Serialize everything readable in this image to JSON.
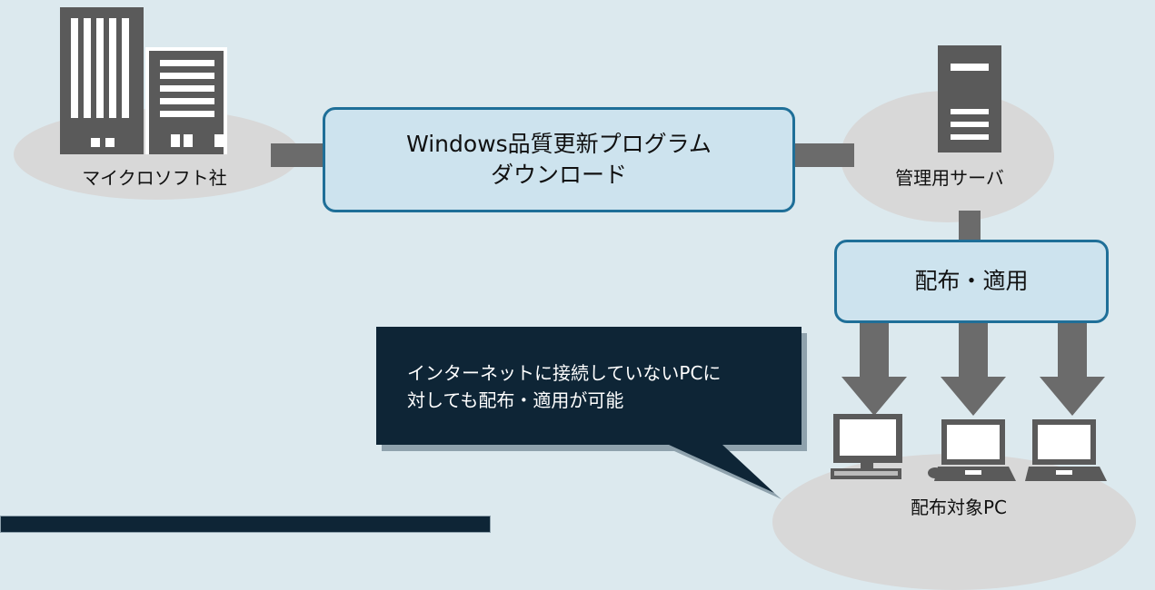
{
  "nodes": {
    "company": {
      "label": "マイクロソフト社"
    },
    "server": {
      "label": "管理用サーバ"
    },
    "pcs": {
      "label": "配布対象PC"
    }
  },
  "download_box": {
    "line1": "Windows品質更新プログラム",
    "line2": "ダウンロード"
  },
  "distribute_box": {
    "label": "配布・適用"
  },
  "callout": {
    "line1": "インターネットに接続していないPCに",
    "line2": "対しても配布・適用が可能"
  },
  "colors": {
    "background": "#dce9ee",
    "ellipse": "#d8d8d8",
    "box_fill": "#cde3ee",
    "box_border": "#1f6f98",
    "callout_fill": "#0e2536",
    "connector": "#6b6b6b",
    "icon": "#5a5a5a"
  },
  "icons": [
    "building-icon",
    "server-icon",
    "desktop-pc-icon",
    "laptop-icon",
    "mouse-icon"
  ]
}
